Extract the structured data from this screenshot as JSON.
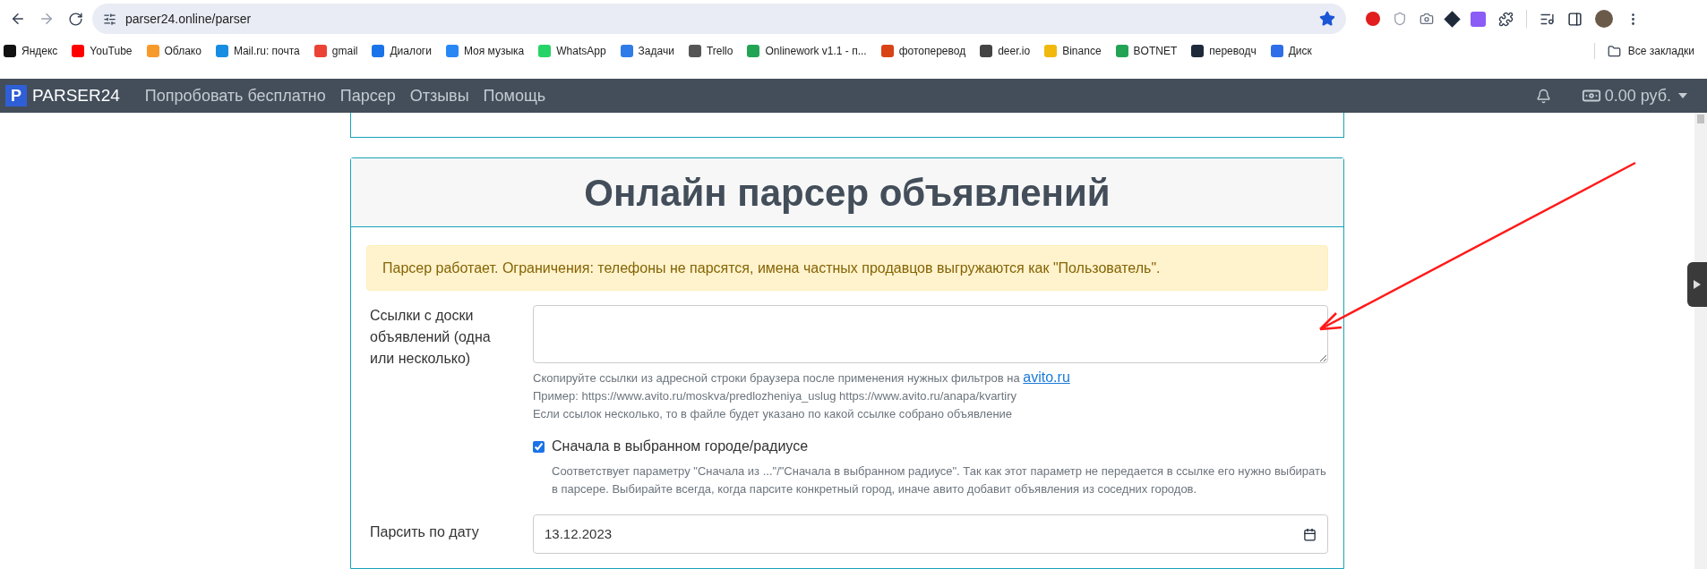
{
  "browser": {
    "url": "parser24.online/parser",
    "bookmarked": true,
    "bookmarks": [
      {
        "label": "Яндекс",
        "color": "#111111"
      },
      {
        "label": "YouTube",
        "color": "#ff0000"
      },
      {
        "label": "Облако",
        "color": "#f79a2a"
      },
      {
        "label": "Mail.ru: почта",
        "color": "#168de2"
      },
      {
        "label": "gmail",
        "color": "#ea4335"
      },
      {
        "label": "Диалоги",
        "color": "#1a73e8"
      },
      {
        "label": "Моя музыка",
        "color": "#2787f5"
      },
      {
        "label": "WhatsApp",
        "color": "#25d366"
      },
      {
        "label": "Задачи",
        "color": "#2f7be8"
      },
      {
        "label": "Trello",
        "color": "#555555"
      },
      {
        "label": "Onlinework v1.1 - п...",
        "color": "#23a455"
      },
      {
        "label": "фотоперевод",
        "color": "#d84315"
      },
      {
        "label": "deer.io",
        "color": "#444444"
      },
      {
        "label": "Binance",
        "color": "#f0b90b"
      },
      {
        "label": "BOTNET",
        "color": "#23a455"
      },
      {
        "label": "переводч",
        "color": "#1e2a3a"
      },
      {
        "label": "Диск",
        "color": "#2f6ee8"
      }
    ],
    "all_bookmarks": "Все закладки"
  },
  "navbar": {
    "logo_letter": "P",
    "brand": "PARSER24",
    "links": [
      "Попробовать бесплатно",
      "Парсер",
      "Отзывы",
      "Помощь"
    ],
    "balance": "0.00 руб."
  },
  "card": {
    "title": "Онлайн парсер объявлений",
    "alert": "Парсер работает. Ограничения: телефоны не парсятся, имена частных продавцов выгружаются как \"Пользователь\".",
    "links_label": "Ссылки с доски объявлений (одна или несколько)",
    "help_lines": [
      "Скопируйте ссылки из адресной строки браузера после применения нужных фильтров на",
      "Пример: https://www.avito.ru/moskva/predlozheniya_uslug https://www.avito.ru/anapa/kvartiry",
      "Если ссылок несколько, то в файле будет указано по какой ссылке собрано объявление"
    ],
    "help_link": "avito.ru",
    "city_first": {
      "label": "Сначала в выбранном городе/радиусе",
      "checked": true,
      "description": "Соответствует параметру \"Сначала из ...\"/\"Сначала в выбранном радиусе\". Так как этот параметр не передается в ссылке его нужно выбирать в парсере. Выбирайте всегда, когда парсите конкретный город, иначе авито добавит объявления из соседних городов."
    },
    "date_label": "Парсить по дату",
    "date_value": "13.12.2023"
  }
}
